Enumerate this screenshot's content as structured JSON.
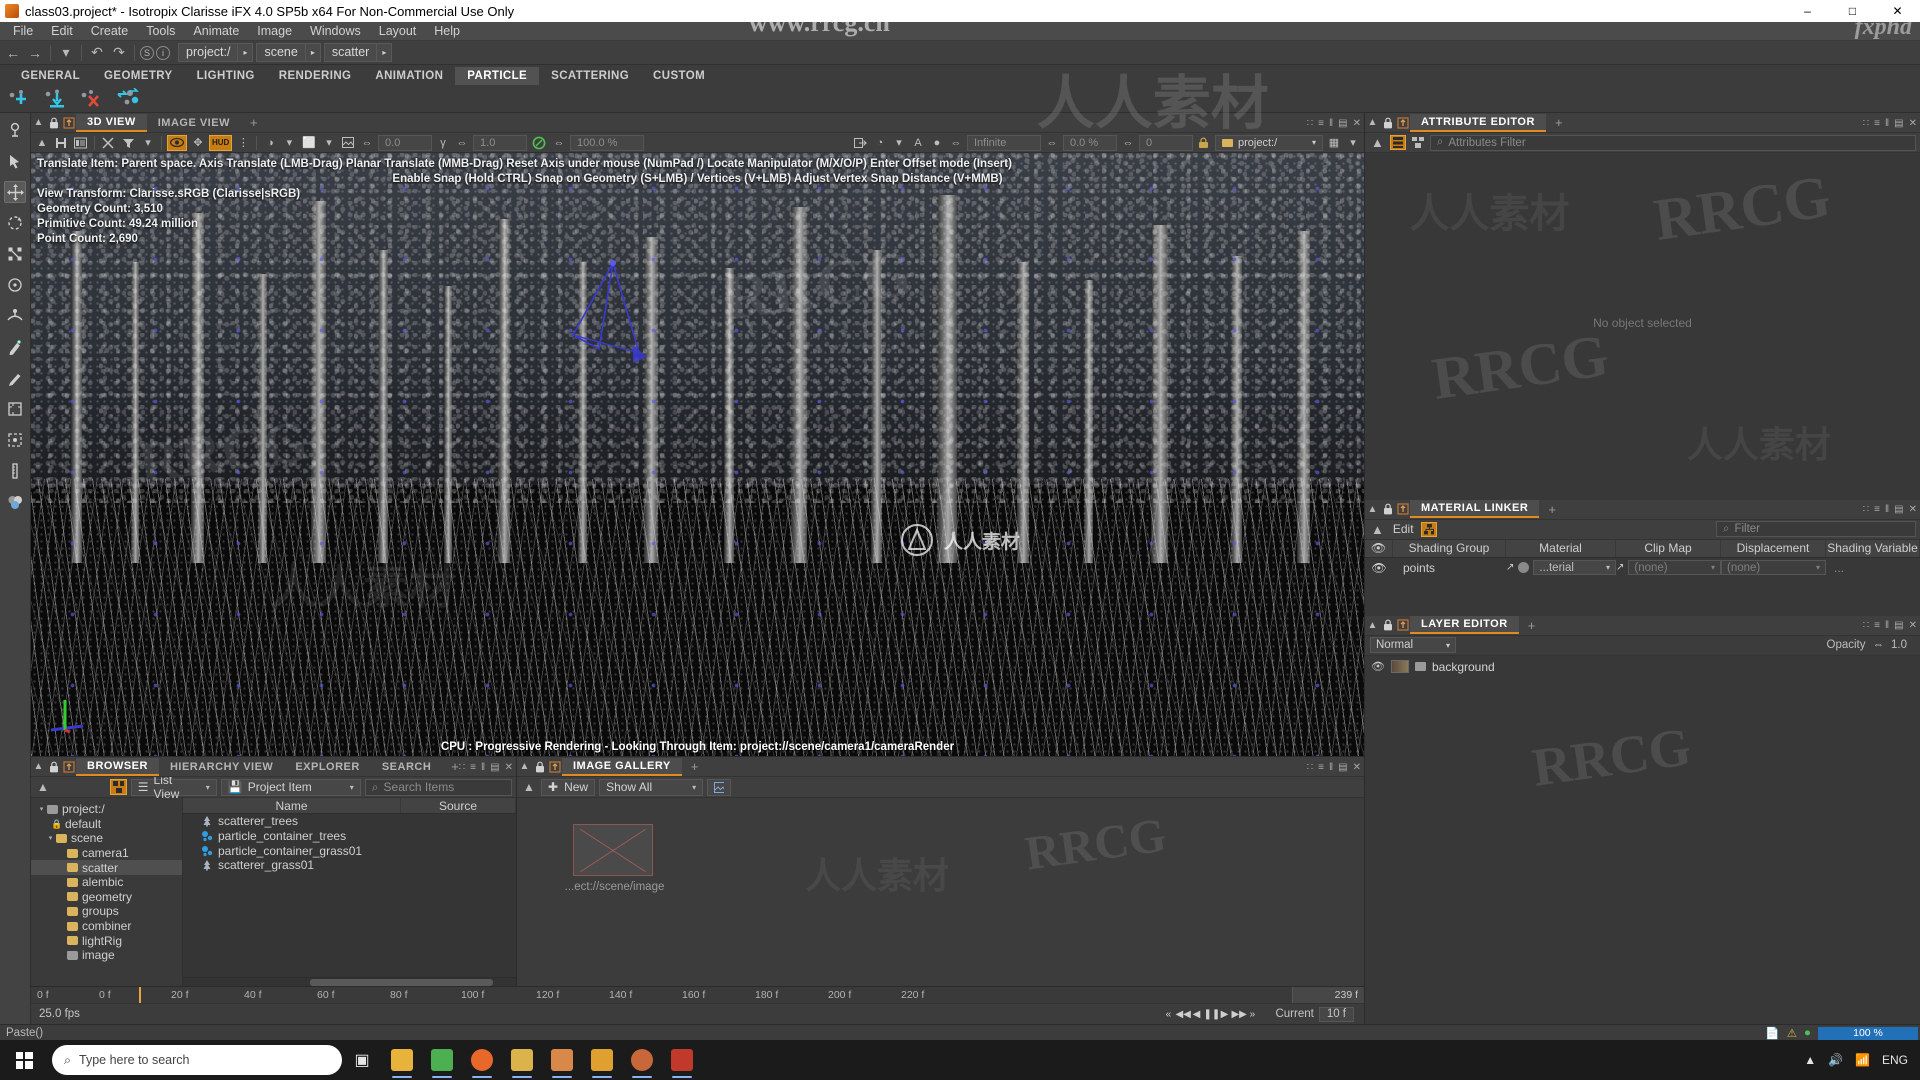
{
  "titlebar": {
    "text": "class03.project* - Isotropix Clarisse iFX 4.0 SP5b x64  For Non-Commercial Use Only",
    "minimize": "–",
    "maximize": "□",
    "close": "✕"
  },
  "menubar": {
    "items": [
      "File",
      "Edit",
      "Create",
      "Tools",
      "Animate",
      "Image",
      "Windows",
      "Layout",
      "Help"
    ]
  },
  "navbar": {
    "back": "←",
    "forward": "→",
    "dropdown": "▾",
    "undo": "↶",
    "redo": "↷",
    "sync": "S",
    "info": "i",
    "crumbs": [
      "project:/",
      "scene",
      "scatter"
    ],
    "crumb_arrow": "▸"
  },
  "shelf": {
    "tabs": [
      "GENERAL",
      "GEOMETRY",
      "LIGHTING",
      "RENDERING",
      "ANIMATION",
      "PARTICLE",
      "SCATTERING",
      "CUSTOM"
    ],
    "active": "PARTICLE",
    "icons": [
      "add-particle-icon",
      "drop-particle-icon",
      "remove-particle-icon",
      "transfer-particle-icon"
    ]
  },
  "lefttoolbar": {
    "tools": [
      "point-light-tool",
      "select-arrow-tool",
      "translate-tool",
      "rotate-tool",
      "scale-tool",
      "snap-tool",
      "surface-tool",
      "paint-tool",
      "brush-tool",
      "frame-tool",
      "box-select-tool",
      "measure-tool",
      "color-tool"
    ],
    "active": "translate-tool"
  },
  "viewport": {
    "tabs": [
      "3D VIEW",
      "IMAGE VIEW"
    ],
    "active_tab": "3D VIEW",
    "plus": "+",
    "toolbar": {
      "save_icon": "💾",
      "snapshot_icon": "⬚",
      "tools_icon": "✂",
      "filter_icon": "▼",
      "eye_icon": "◉",
      "gizmo_icon": "✥",
      "hud_label": "HUD",
      "shading_icon": "◑",
      "display_icon": "⬜",
      "image_icon": "⬛",
      "value_1": "0.0",
      "gamma_icon": "γ",
      "value_2": "1.0",
      "exposure_icon": "⌀",
      "value_3": "100.0 %",
      "light_icon": "◔",
      "text_icon": "A",
      "infinite": "Infinite",
      "value_4": "0.0 %",
      "value_5": "0",
      "lock_icon": "🔒",
      "path_value": "project:/",
      "grid_icon": "▦"
    },
    "hud_lines": [
      "Translate Item: Parent space. Axis Translate (LMB-Drag)  Planar Translate (MMB-Drag)  Reset Axis under mouse (NumPad /)  Locate Manipulator (M/X/O/P)  Enter Offset mode (Insert)",
      "Enable Snap (Hold CTRL) Snap on Geometry (S+LMB) / Vertices (V+LMB) Adjust Vertex Snap Distance (V+MMB)",
      "View Transform: Clarisse.sRGB (Clarisse|sRGB)",
      "Geometry Count: 3,510",
      "Primitive Count: 49.24 million",
      "Point Count: 2,690"
    ],
    "status": "CPU : Progressive Rendering - Looking Through Item: project://scene/camera1/cameraRender",
    "panel_buttons": [
      "∷",
      "≡",
      "‖",
      "▤",
      "✕"
    ]
  },
  "browser": {
    "tabs": [
      "BROWSER",
      "HIERARCHY VIEW",
      "EXPLORER",
      "SEARCH"
    ],
    "active_tab": "BROWSER",
    "plus": "+",
    "toolbar": {
      "tree_toggle_icon": "⊞",
      "view_mode": "List View",
      "filter_mode": "Project Item",
      "search_placeholder": "Search Items",
      "search_icon": "⌕",
      "caret": "▾"
    },
    "tree": [
      {
        "label": "project:/",
        "depth": 0,
        "icon": "folder-grey",
        "expand": "▾"
      },
      {
        "label": "default",
        "depth": 1,
        "icon": "lock",
        "expand": ""
      },
      {
        "label": "scene",
        "depth": 1,
        "icon": "folder-gold",
        "expand": "▾"
      },
      {
        "label": "camera1",
        "depth": 2,
        "icon": "folder-gold",
        "expand": ""
      },
      {
        "label": "scatter",
        "depth": 2,
        "icon": "folder-gold",
        "expand": "",
        "selected": true
      },
      {
        "label": "alembic",
        "depth": 2,
        "icon": "folder-gold",
        "expand": ""
      },
      {
        "label": "geometry",
        "depth": 2,
        "icon": "folder-gold",
        "expand": ""
      },
      {
        "label": "groups",
        "depth": 2,
        "icon": "folder-gold",
        "expand": ""
      },
      {
        "label": "combiner",
        "depth": 2,
        "icon": "folder-gold",
        "expand": ""
      },
      {
        "label": "lightRig",
        "depth": 2,
        "icon": "folder-gold",
        "expand": ""
      },
      {
        "label": "image",
        "depth": 2,
        "icon": "folder-grey",
        "expand": ""
      }
    ],
    "columns": [
      "Name",
      "Source"
    ],
    "items": [
      {
        "name": "scatterer_trees",
        "icon": "scatterer-icon",
        "color": "#9fb0c0"
      },
      {
        "name": "particle_container_trees",
        "icon": "particle-icon",
        "color": "#4aa8e0"
      },
      {
        "name": "particle_container_grass01",
        "icon": "particle-icon",
        "color": "#4aa8e0"
      },
      {
        "name": "scatterer_grass01",
        "icon": "scatterer-icon",
        "color": "#9fb0c0"
      }
    ]
  },
  "gallery": {
    "tabs": [
      "IMAGE GALLERY"
    ],
    "active_tab": "IMAGE GALLERY",
    "plus": "+",
    "new_label": "New",
    "filter_value": "Show All",
    "caret": "▾",
    "image_button_icon": "🖼",
    "thumb_caption": "...ect://scene/image",
    "panel_buttons": [
      "∷",
      "≡",
      "‖",
      "▤",
      "✕"
    ]
  },
  "timeline": {
    "ticks": [
      "0 f",
      "0 f",
      "20 f",
      "40 f",
      "60 f",
      "80 f",
      "100 f",
      "120 f",
      "140 f",
      "160 f",
      "180 f",
      "200 f",
      "220 f"
    ],
    "end_frame": "239 f",
    "fps": "25.0 fps",
    "transport": [
      "«",
      "◀◀",
      "◀",
      "❚❚",
      "▶",
      "▶▶",
      "»"
    ],
    "current_label": "Current",
    "current_value": "10 f"
  },
  "attribute_editor": {
    "title": "ATTRIBUTE EDITOR",
    "plus": "+",
    "lock_icon": "🔒",
    "pin_icon": "⬆",
    "filter_placeholder": "Attributes Filter",
    "search_icon": "⌕",
    "empty_text": "No object selected",
    "panel_buttons": [
      "∷",
      "≡",
      "‖",
      "▤",
      "✕"
    ]
  },
  "material_linker": {
    "title": "MATERIAL LINKER",
    "plus": "+",
    "edit_label": "Edit",
    "filter_placeholder": "Filter",
    "search_icon": "⌕",
    "columns": [
      "Shading Group",
      "Material",
      "Clip Map",
      "Displacement",
      "Shading Variable"
    ],
    "rows": [
      {
        "shading_group": "points",
        "material": "...terial",
        "clip_map": "(none)",
        "displacement": "(none)",
        "shading_variable": "..."
      }
    ],
    "panel_buttons": [
      "∷",
      "≡",
      "‖",
      "▤",
      "✕"
    ]
  },
  "layer_editor": {
    "title": "LAYER EDITOR",
    "plus": "+",
    "blend_mode": "Normal",
    "opacity_label": "Opacity",
    "opacity_value": "1.0",
    "rows": [
      {
        "name": "background"
      }
    ],
    "panel_buttons": [
      "∷",
      "≡",
      "‖",
      "▤",
      "✕"
    ]
  },
  "statusbar": {
    "left": "Paste()",
    "progress": "100 %",
    "warn_icon": "⚠",
    "ok_icon": "●"
  },
  "taskbar": {
    "search_placeholder": "Type here to search",
    "search_icon": "⌕",
    "task_view_icon": "▣",
    "apps": [
      {
        "name": "file-explorer-app",
        "color": "#e8b33a"
      },
      {
        "name": "green-app",
        "color": "#4caf50"
      },
      {
        "name": "firefox-app",
        "color": "#e8682a"
      },
      {
        "name": "folder-app",
        "color": "#dcb24a"
      },
      {
        "name": "clarisse-app",
        "color": "#d8894a"
      },
      {
        "name": "orange-app",
        "color": "#e0a030"
      },
      {
        "name": "globe-app",
        "color": "#c8673a"
      },
      {
        "name": "red-app",
        "color": "#c0392b"
      }
    ],
    "tray": [
      "▲",
      "🔊",
      "📶",
      "ENG"
    ],
    "time": ""
  },
  "watermarks": {
    "site": "www.rrcg.cn",
    "brand": "RRCG",
    "cn": "人人素材",
    "corner": "fxphd"
  }
}
